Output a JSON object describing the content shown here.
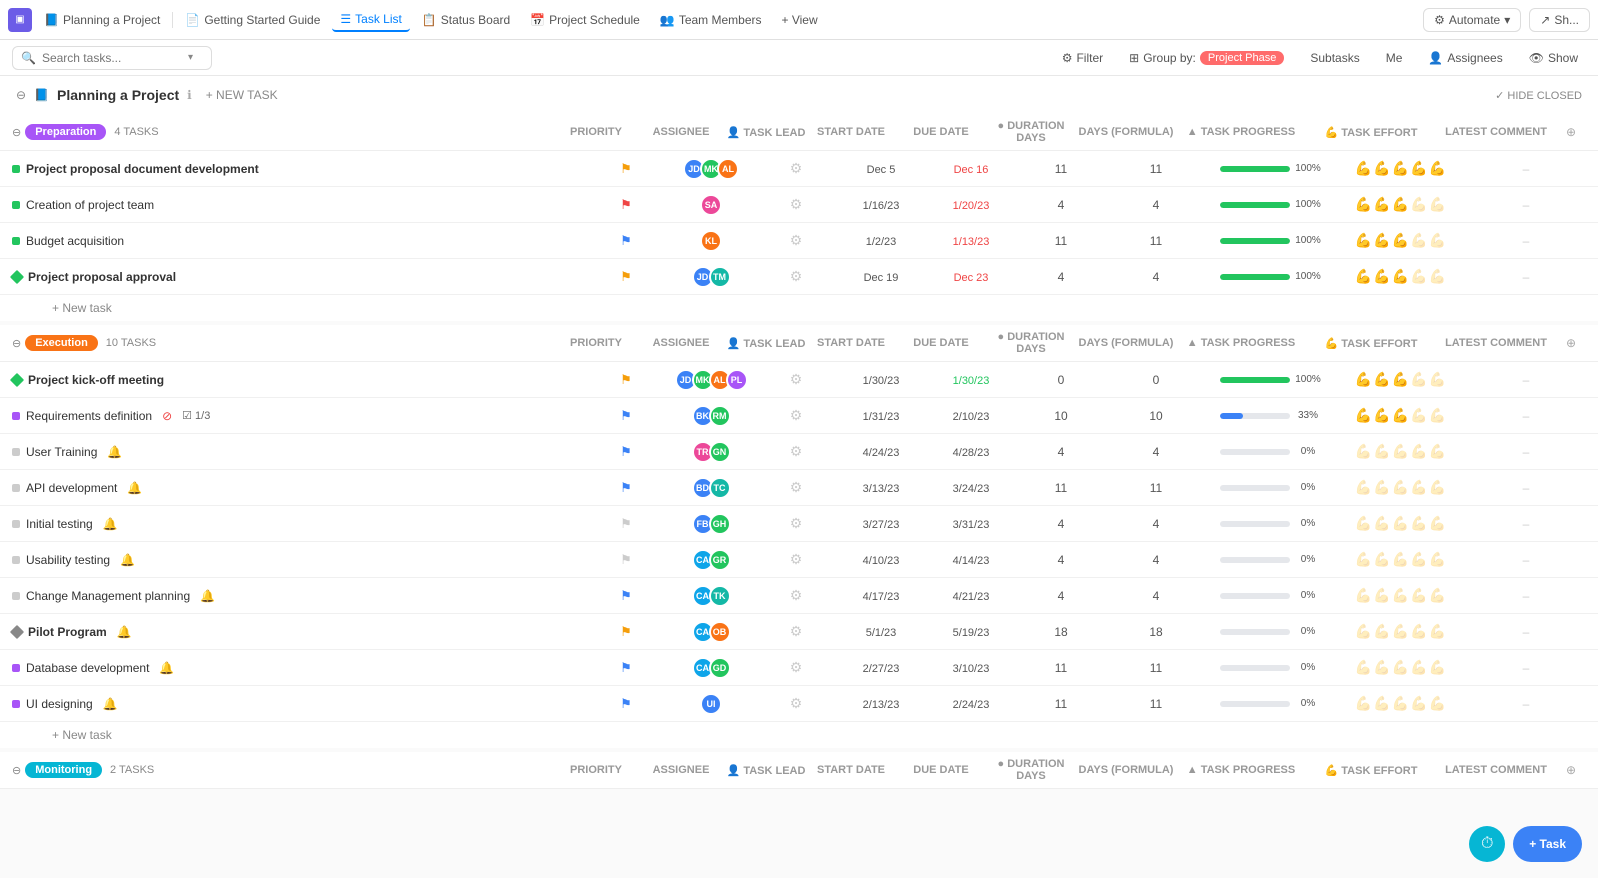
{
  "topNav": {
    "logo": "▣",
    "projectTitle": "Planning a Project",
    "tabs": [
      {
        "id": "getting-started",
        "label": "Getting Started Guide",
        "icon": "📄",
        "active": false
      },
      {
        "id": "task-list",
        "label": "Task List",
        "icon": "☰",
        "active": true
      },
      {
        "id": "status-board",
        "label": "Status Board",
        "icon": "📋",
        "active": false
      },
      {
        "id": "project-schedule",
        "label": "Project Schedule",
        "icon": "📅",
        "active": false
      },
      {
        "id": "team-members",
        "label": "Team Members",
        "icon": "👥",
        "active": false
      },
      {
        "id": "view",
        "label": "+ View",
        "icon": "",
        "active": false
      }
    ],
    "automate": "Automate",
    "share": "Sh..."
  },
  "toolbar": {
    "searchPlaceholder": "Search tasks...",
    "filter": "Filter",
    "groupBy": "Group by:",
    "groupByValue": "Project Phase",
    "subtasks": "Subtasks",
    "me": "Me",
    "assignees": "Assignees",
    "show": "Show"
  },
  "projectHeader": {
    "icon": "📘",
    "title": "Planning a Project",
    "newTask": "+ NEW TASK",
    "hideClosed": "✓ HIDE CLOSED"
  },
  "columns": {
    "name": "",
    "priority": "PRIORITY",
    "assignee": "ASSIGNEE",
    "taskLead": "TASK LEAD",
    "startDate": "START DATE",
    "dueDate": "DUE DATE",
    "duration": "DURATION DAYS",
    "daysFormula": "DAYS (FORMULA)",
    "progress": "TASK PROGRESS",
    "effort": "TASK EFFORT",
    "comment": "LATEST COMMENT"
  },
  "groups": [
    {
      "id": "preparation",
      "label": "Preparation",
      "tagClass": "tag-preparation",
      "count": "4 TASKS",
      "tasks": [
        {
          "name": "Project proposal document development",
          "bold": true,
          "dotType": "dot-green",
          "flag": "🚩",
          "flagClass": "flag-yellow",
          "avatars": [
            "blue",
            "green",
            "orange"
          ],
          "startDate": "",
          "startDateClass": "date-normal",
          "dueDate": "Dec 5",
          "dueDateClass": "date-normal",
          "dueDate2": "Dec 16",
          "dueDate2Class": "date-red",
          "duration": "11",
          "daysFormula": "11",
          "progressPct": 100,
          "progressType": "full",
          "effortCount": 5,
          "effortFilled": 5
        },
        {
          "name": "Creation of project team",
          "bold": false,
          "dotType": "dot-green",
          "flag": "🚩",
          "flagClass": "flag-red",
          "avatars": [
            "pink"
          ],
          "startDate": "1/16/23",
          "startDateClass": "date-normal",
          "dueDate": "1/20/23",
          "dueDateClass": "date-red",
          "duration": "4",
          "daysFormula": "4",
          "progressPct": 100,
          "progressType": "full",
          "effortCount": 5,
          "effortFilled": 3
        },
        {
          "name": "Budget acquisition",
          "bold": false,
          "dotType": "dot-green",
          "flag": "⚑",
          "flagClass": "flag-blue",
          "avatars": [
            "orange2"
          ],
          "startDate": "1/2/23",
          "startDateClass": "date-normal",
          "dueDate": "1/13/23",
          "dueDateClass": "date-red",
          "duration": "11",
          "daysFormula": "11",
          "progressPct": 100,
          "progressType": "full",
          "effortCount": 5,
          "effortFilled": 3
        },
        {
          "name": "Project proposal approval",
          "bold": true,
          "dotType": "dot-diamond",
          "flag": "⚑",
          "flagClass": "flag-yellow",
          "avatars": [
            "blue2",
            "green2"
          ],
          "startDate": "",
          "startDateClass": "date-normal",
          "dueDate": "Dec 19",
          "dueDateClass": "date-normal",
          "dueDate2": "Dec 23",
          "dueDate2Class": "date-red",
          "duration": "4",
          "daysFormula": "4",
          "progressPct": 100,
          "progressType": "full",
          "effortCount": 5,
          "effortFilled": 3
        }
      ]
    },
    {
      "id": "execution",
      "label": "Execution",
      "tagClass": "tag-execution",
      "count": "10 TASKS",
      "tasks": [
        {
          "name": "Project kick-off meeting",
          "bold": true,
          "dotType": "dot-diamond",
          "flag": "⚑",
          "flagClass": "flag-yellow",
          "avatars": [
            "blue",
            "green",
            "orange",
            "purple"
          ],
          "startDate": "1/30/23",
          "startDateClass": "date-normal",
          "dueDate": "1/30/23",
          "dueDateClass": "date-green",
          "duration": "0",
          "daysFormula": "0",
          "progressPct": 100,
          "progressType": "full",
          "effortCount": 5,
          "effortFilled": 3
        },
        {
          "name": "Requirements definition",
          "bold": false,
          "dotType": "dot-purple",
          "flag": "⚑",
          "flagClass": "flag-blue",
          "avatars": [
            "blue3",
            "green3"
          ],
          "hasMeta": true,
          "metaStop": true,
          "metaCheck": "1/3",
          "startDate": "1/31/23",
          "startDateClass": "date-normal",
          "dueDate": "2/10/23",
          "dueDateClass": "date-normal",
          "duration": "10",
          "daysFormula": "10",
          "progressPct": 33,
          "progressType": "partial",
          "effortCount": 5,
          "effortFilled": 3
        },
        {
          "name": "User Training",
          "bold": false,
          "dotType": "dot-gray",
          "flag": "⚑",
          "flagClass": "flag-blue",
          "avatars": [
            "pink2",
            "green4"
          ],
          "hasYellow": true,
          "startDate": "4/24/23",
          "startDateClass": "date-normal",
          "dueDate": "4/28/23",
          "dueDateClass": "date-normal",
          "duration": "4",
          "daysFormula": "4",
          "progressPct": 0,
          "progressType": "empty",
          "effortCount": 5,
          "effortFilled": 0
        },
        {
          "name": "API development",
          "bold": false,
          "dotType": "dot-gray",
          "flag": "⚑",
          "flagClass": "flag-blue",
          "avatars": [
            "blue4",
            "green5"
          ],
          "hasYellow": true,
          "startDate": "3/13/23",
          "startDateClass": "date-normal",
          "dueDate": "3/24/23",
          "dueDateClass": "date-normal",
          "duration": "11",
          "daysFormula": "11",
          "progressPct": 0,
          "progressType": "empty",
          "effortCount": 5,
          "effortFilled": 0
        },
        {
          "name": "Initial testing",
          "bold": false,
          "dotType": "dot-gray",
          "flag": "⚑",
          "flagClass": "flag-gray",
          "avatars": [
            "blue5",
            "green6"
          ],
          "hasYellow": true,
          "startDate": "3/27/23",
          "startDateClass": "date-normal",
          "dueDate": "3/31/23",
          "dueDateClass": "date-normal",
          "duration": "4",
          "daysFormula": "4",
          "progressPct": 0,
          "progressType": "empty",
          "effortCount": 5,
          "effortFilled": 0
        },
        {
          "name": "Usability testing",
          "bold": false,
          "dotType": "dot-gray",
          "flag": "⚑",
          "flagClass": "flag-gray",
          "avatars": [
            "ca",
            "green7"
          ],
          "hasYellow": true,
          "startDate": "4/10/23",
          "startDateClass": "date-normal",
          "dueDate": "4/14/23",
          "dueDateClass": "date-normal",
          "duration": "4",
          "daysFormula": "4",
          "progressPct": 0,
          "progressType": "empty",
          "effortCount": 5,
          "effortFilled": 0
        },
        {
          "name": "Change Management planning",
          "bold": false,
          "dotType": "dot-gray",
          "flag": "⚑",
          "flagClass": "flag-blue",
          "avatars": [
            "ca",
            "green8"
          ],
          "hasYellow": true,
          "startDate": "4/17/23",
          "startDateClass": "date-normal",
          "dueDate": "4/21/23",
          "dueDateClass": "date-normal",
          "duration": "4",
          "daysFormula": "4",
          "progressPct": 0,
          "progressType": "empty",
          "effortCount": 5,
          "effortFilled": 0
        },
        {
          "name": "Pilot Program",
          "bold": true,
          "dotType": "dot-diamond-gray",
          "flag": "⚑",
          "flagClass": "flag-yellow",
          "avatars": [
            "ca",
            "green9"
          ],
          "hasYellow": true,
          "startDate": "5/1/23",
          "startDateClass": "date-normal",
          "dueDate": "5/19/23",
          "dueDateClass": "date-normal",
          "duration": "18",
          "daysFormula": "18",
          "progressPct": 0,
          "progressType": "empty",
          "effortCount": 5,
          "effortFilled": 0
        },
        {
          "name": "Database development",
          "bold": false,
          "dotType": "dot-purple",
          "flag": "⚑",
          "flagClass": "flag-blue",
          "avatars": [
            "ca",
            "green10"
          ],
          "hasYellow": true,
          "startDate": "2/27/23",
          "startDateClass": "date-normal",
          "dueDate": "3/10/23",
          "dueDateClass": "date-normal",
          "duration": "11",
          "daysFormula": "11",
          "progressPct": 0,
          "progressType": "empty",
          "effortCount": 5,
          "effortFilled": 0
        },
        {
          "name": "UI designing",
          "bold": false,
          "dotType": "dot-purple",
          "flag": "⚑",
          "flagClass": "flag-blue",
          "avatars": [
            "blue6"
          ],
          "hasYellow": true,
          "startDate": "2/13/23",
          "startDateClass": "date-normal",
          "dueDate": "2/24/23",
          "dueDateClass": "date-normal",
          "duration": "11",
          "daysFormula": "11",
          "progressPct": 0,
          "progressType": "empty",
          "effortCount": 5,
          "effortFilled": 0
        }
      ]
    },
    {
      "id": "monitoring",
      "label": "Monitoring",
      "tagClass": "tag-monitoring",
      "count": "2 TASKS",
      "tasks": []
    }
  ],
  "bottomBtns": {
    "timer": "⏱",
    "task": "+ Task"
  }
}
